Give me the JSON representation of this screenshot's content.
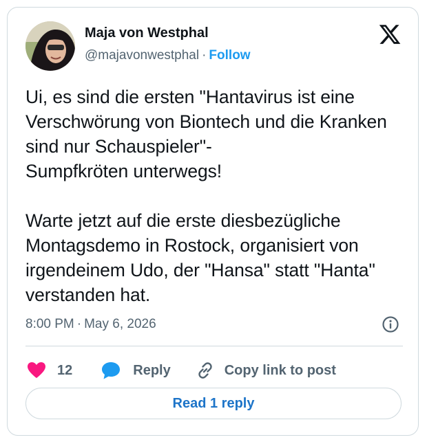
{
  "tweet": {
    "author": {
      "name": "Maja von Westphal",
      "handle": "@majavonwestphal",
      "separator": "·",
      "follow_label": "Follow"
    },
    "text": "Ui, es sind die ersten \"Hantavirus ist eine Verschwörung von Biontech und die Kranken sind nur Schauspieler\"-\nSumpfkröten unterwegs!\n\nWarte jetzt auf die erste diesbezügliche Montagsdemo in Rostock, organisiert von irgendeinem Udo, der \"Hansa\" statt \"Hanta\" verstanden hat.",
    "time": "8:00 PM",
    "separator": "·",
    "date": "May 6, 2026",
    "actions": {
      "like_count": "12",
      "reply_label": "Reply",
      "copy_link_label": "Copy link to post"
    },
    "read_reply_label": "Read 1 reply"
  },
  "icons": {
    "brand": "x-logo",
    "like": "heart-icon",
    "reply": "speech-bubble-icon",
    "copy": "link-icon",
    "info": "info-icon"
  },
  "colors": {
    "link": "#1d9bf0",
    "heart": "#f91880",
    "secondary_text": "#536471",
    "border": "#cfd9de"
  }
}
